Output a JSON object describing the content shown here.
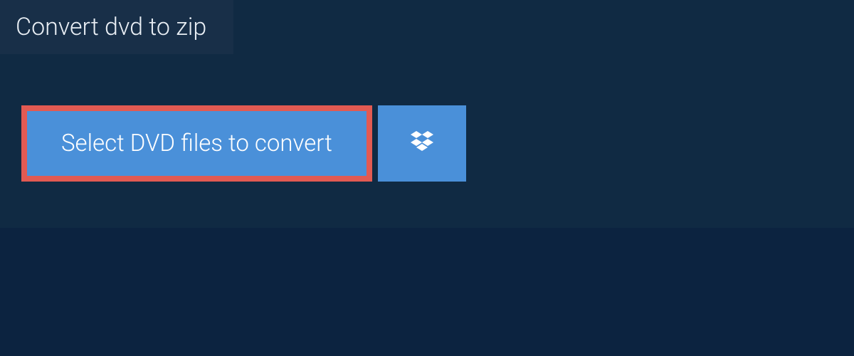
{
  "tab": {
    "title": "Convert dvd to zip"
  },
  "actions": {
    "select_files_label": "Select DVD files to convert"
  },
  "colors": {
    "background": "#0c2340",
    "panel": "#102a43",
    "tab": "#182f48",
    "button": "#4a90d9",
    "highlight_border": "#e25a52"
  }
}
